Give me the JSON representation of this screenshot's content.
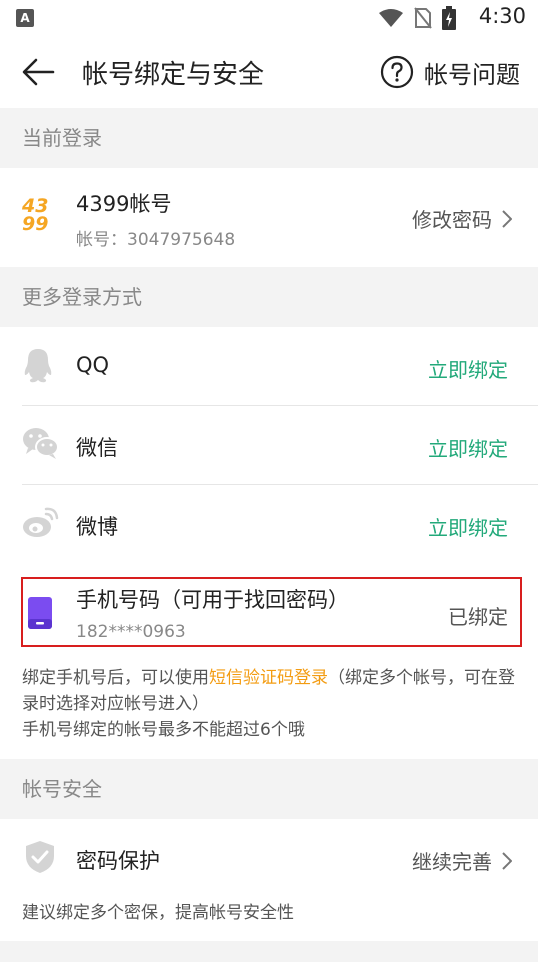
{
  "status_bar": {
    "left_badge": "A",
    "time": "4:30"
  },
  "header": {
    "title": "帐号绑定与安全",
    "help_label": "帐号问题"
  },
  "current_login": {
    "section_title": "当前登录",
    "account_name": "4399帐号",
    "account_id": "帐号：3047975648",
    "logo_text_top": "43",
    "logo_text_bottom": "99",
    "action": "修改密码"
  },
  "more_login": {
    "section_title": "更多登录方式",
    "items": [
      {
        "label": "QQ",
        "action": "立即绑定",
        "icon": "qq-icon"
      },
      {
        "label": "微信",
        "action": "立即绑定",
        "icon": "wechat-icon"
      },
      {
        "label": "微博",
        "action": "立即绑定",
        "icon": "weibo-icon"
      }
    ],
    "phone": {
      "label": "手机号码（可用于找回密码）",
      "number": "182****0963",
      "status": "已绑定"
    },
    "note_pre": "绑定手机号后，可以使用",
    "note_highlight": "短信验证码登录",
    "note_post": "（绑定多个帐号，可在登录时选择对应帐号进入）",
    "note_line2": "手机号绑定的帐号最多不能超过6个哦"
  },
  "security": {
    "section_title": "帐号安全",
    "item_label": "密码保护",
    "item_action": "继续完善",
    "note": "建议绑定多个密保，提高帐号安全性"
  },
  "colors": {
    "accent_green": "#22a97a",
    "highlight_orange": "#f39c12",
    "logo_orange": "#f5a623",
    "phone_purple": "#7b4cf0",
    "frame_red": "#d81e1e"
  }
}
